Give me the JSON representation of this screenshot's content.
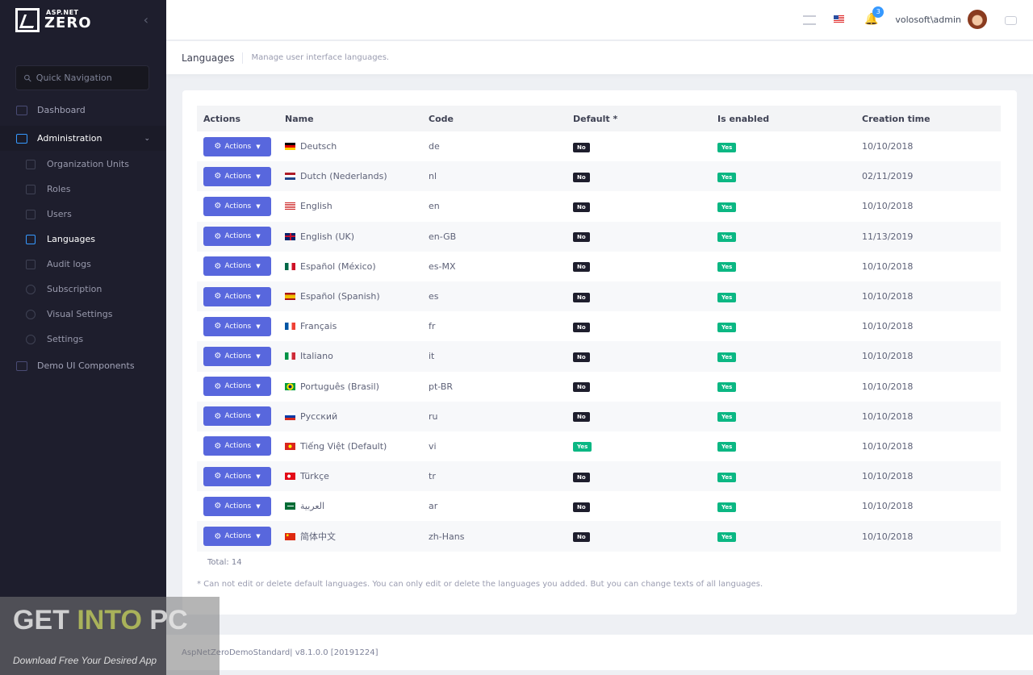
{
  "brand": {
    "small": "ASP.NET",
    "big": "ZERO"
  },
  "search": {
    "placeholder": "Quick Navigation"
  },
  "sidebar": {
    "dashboard": "Dashboard",
    "administration": "Administration",
    "admin_items": [
      "Organization Units",
      "Roles",
      "Users",
      "Languages",
      "Audit logs",
      "Subscription",
      "Visual Settings",
      "Settings"
    ],
    "demo": "Demo UI Components"
  },
  "header": {
    "notifications_count": "3",
    "username": "volosoft\\admin"
  },
  "page": {
    "title": "Languages",
    "description": "Manage user interface languages."
  },
  "table": {
    "columns": [
      "Actions",
      "Name",
      "Code",
      "Default *",
      "Is enabled",
      "Creation time"
    ],
    "action_label": "Actions",
    "rows": [
      {
        "name": "Deutsch",
        "code": "de",
        "default": "No",
        "enabled": "Yes",
        "created": "10/10/2018",
        "flag": "de"
      },
      {
        "name": "Dutch (Nederlands)",
        "code": "nl",
        "default": "No",
        "enabled": "Yes",
        "created": "02/11/2019",
        "flag": "nl"
      },
      {
        "name": "English",
        "code": "en",
        "default": "No",
        "enabled": "Yes",
        "created": "10/10/2018",
        "flag": "us"
      },
      {
        "name": "English (UK)",
        "code": "en-GB",
        "default": "No",
        "enabled": "Yes",
        "created": "11/13/2019",
        "flag": "gb"
      },
      {
        "name": "Español (México)",
        "code": "es-MX",
        "default": "No",
        "enabled": "Yes",
        "created": "10/10/2018",
        "flag": "mx"
      },
      {
        "name": "Español (Spanish)",
        "code": "es",
        "default": "No",
        "enabled": "Yes",
        "created": "10/10/2018",
        "flag": "es"
      },
      {
        "name": "Français",
        "code": "fr",
        "default": "No",
        "enabled": "Yes",
        "created": "10/10/2018",
        "flag": "fr"
      },
      {
        "name": "Italiano",
        "code": "it",
        "default": "No",
        "enabled": "Yes",
        "created": "10/10/2018",
        "flag": "it"
      },
      {
        "name": "Português (Brasil)",
        "code": "pt-BR",
        "default": "No",
        "enabled": "Yes",
        "created": "10/10/2018",
        "flag": "br"
      },
      {
        "name": "Pусский",
        "code": "ru",
        "default": "No",
        "enabled": "Yes",
        "created": "10/10/2018",
        "flag": "ru"
      },
      {
        "name": "Tiếng Việt (Default)",
        "code": "vi",
        "default": "Yes",
        "enabled": "Yes",
        "created": "10/10/2018",
        "flag": "vn"
      },
      {
        "name": "Türkçe",
        "code": "tr",
        "default": "No",
        "enabled": "Yes",
        "created": "10/10/2018",
        "flag": "tr"
      },
      {
        "name": "العربية",
        "code": "ar",
        "default": "No",
        "enabled": "Yes",
        "created": "10/10/2018",
        "flag": "sa"
      },
      {
        "name": "简体中文",
        "code": "zh-Hans",
        "default": "No",
        "enabled": "Yes",
        "created": "10/10/2018",
        "flag": "cn"
      }
    ],
    "total": "Total: 14"
  },
  "note": "* Can not edit or delete default languages. You can only edit or delete the languages you added. But you can change texts of all languages.",
  "footer": "AspNetZeroDemoStandard| v8.1.0.0 [20191224]",
  "watermark": {
    "get": "GET ",
    "into": "INTO",
    "pc": " PC",
    "tagline": "Download Free Your Desired App"
  },
  "colors": {
    "sidebar": "#1e1e2d",
    "action_button": "#5867dd",
    "yes": "#0bb783",
    "no": "#1e1e2d"
  }
}
